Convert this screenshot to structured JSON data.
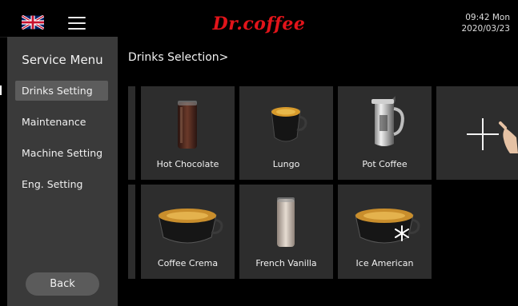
{
  "header": {
    "brand": "Dr.coffee",
    "time": "09:42 Mon",
    "date": "2020/03/23",
    "flag_icon": "uk-flag-icon",
    "menu_icon": "hamburger-menu-icon"
  },
  "sidebar": {
    "title": "Service Menu",
    "items": [
      {
        "label": "Drinks Setting",
        "active": true
      },
      {
        "label": "Maintenance",
        "active": false
      },
      {
        "label": "Machine Setting",
        "active": false
      },
      {
        "label": "Eng. Setting",
        "active": false
      }
    ],
    "back_label": "Back"
  },
  "main": {
    "breadcrumb": "Drinks Selection>",
    "drinks": [
      {
        "label": "Hot Chocolate",
        "icon": "hot-chocolate-glass-icon"
      },
      {
        "label": "Lungo",
        "icon": "lungo-cup-icon"
      },
      {
        "label": "Pot Coffee",
        "icon": "coffee-pot-icon"
      },
      {
        "label": "Coffee Crema",
        "icon": "coffee-crema-cup-icon"
      },
      {
        "label": "French Vanilla",
        "icon": "french-vanilla-glass-icon"
      },
      {
        "label": "Ice American",
        "icon": "ice-american-cup-icon"
      }
    ],
    "add_icon": "add-drink-plus-icon"
  },
  "colors": {
    "brand": "#e2141a",
    "sidebar_bg": "#3a3a3a",
    "tile_bg": "#2d2d2d",
    "page_bg": "#000000"
  }
}
